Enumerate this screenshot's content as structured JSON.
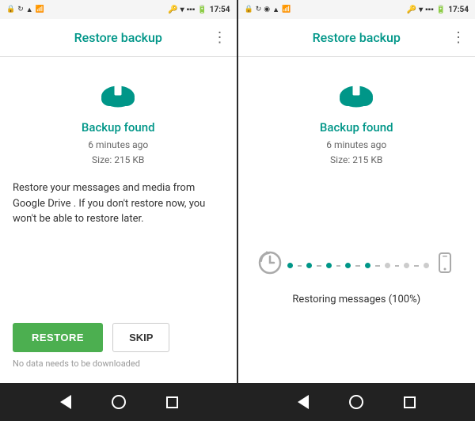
{
  "screen1": {
    "statusBar": {
      "time": "17:54",
      "icons": [
        "signal",
        "wifi",
        "battery"
      ]
    },
    "topBar": {
      "title": "Restore backup",
      "menuIcon": "⋮"
    },
    "cloud": {
      "ariaLabel": "cloud-upload-icon"
    },
    "backupFound": "Backup found",
    "backupMeta": {
      "time": "6 minutes ago",
      "size": "Size: 215 KB"
    },
    "description": "Restore your messages and media from Google Drive . If you don't restore now, you won't be able to restore later.",
    "buttons": {
      "restore": "RESTORE",
      "skip": "SKIP"
    },
    "noDownload": "No data needs to be downloaded"
  },
  "screen2": {
    "statusBar": {
      "time": "17:54"
    },
    "topBar": {
      "title": "Restore backup",
      "menuIcon": "⋮"
    },
    "backupFound": "Backup found",
    "backupMeta": {
      "time": "6 minutes ago",
      "size": "Size: 215 KB"
    },
    "progressDots": [
      {
        "color": "#009688"
      },
      {
        "color": "#009688"
      },
      {
        "color": "#009688"
      },
      {
        "color": "#009688"
      },
      {
        "color": "#009688"
      },
      {
        "color": "#ccc"
      },
      {
        "color": "#ccc"
      },
      {
        "color": "#ccc"
      }
    ],
    "restoringLabel": "Restoring messages (100%)"
  },
  "navBar": {
    "backLabel": "back",
    "homeLabel": "home",
    "recentsLabel": "recents"
  }
}
